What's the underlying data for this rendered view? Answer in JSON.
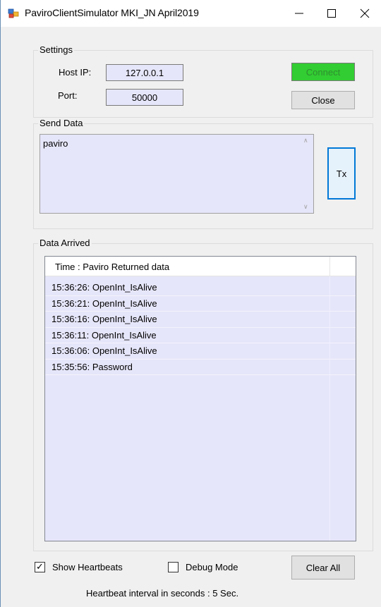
{
  "window": {
    "title": "PaviroClientSimulator MKI_JN April2019",
    "icons": [
      "app-icon",
      "minimize-icon",
      "maximize-icon",
      "close-icon"
    ]
  },
  "settings": {
    "legend": "Settings",
    "host_label": "Host IP:",
    "host_value": "127.0.0.1",
    "port_label": "Port:",
    "port_value": "50000",
    "connect_label": "Connect",
    "close_label": "Close",
    "connect_color": "#32cd32"
  },
  "send": {
    "legend": "Send Data",
    "text": "paviro",
    "tx_label": "Tx"
  },
  "arrived": {
    "legend": "Data Arrived",
    "header": "Time   : Paviro Returned data",
    "rows": [
      "15:36:26: OpenInt_IsAlive",
      "15:36:21: OpenInt_IsAlive",
      "15:36:16: OpenInt_IsAlive",
      "15:36:11: OpenInt_IsAlive",
      "15:36:06: OpenInt_IsAlive",
      "15:35:56: Password"
    ]
  },
  "options": {
    "show_heartbeats_label": "Show Heartbeats",
    "show_heartbeats_checked": true,
    "debug_mode_label": "Debug Mode",
    "debug_mode_checked": false,
    "clear_all_label": "Clear All"
  },
  "footer": {
    "text": "Heartbeat interval in seconds :  5 Sec."
  },
  "colors": {
    "field_background": "#e6e6fa",
    "focus_border": "#0078d7"
  }
}
